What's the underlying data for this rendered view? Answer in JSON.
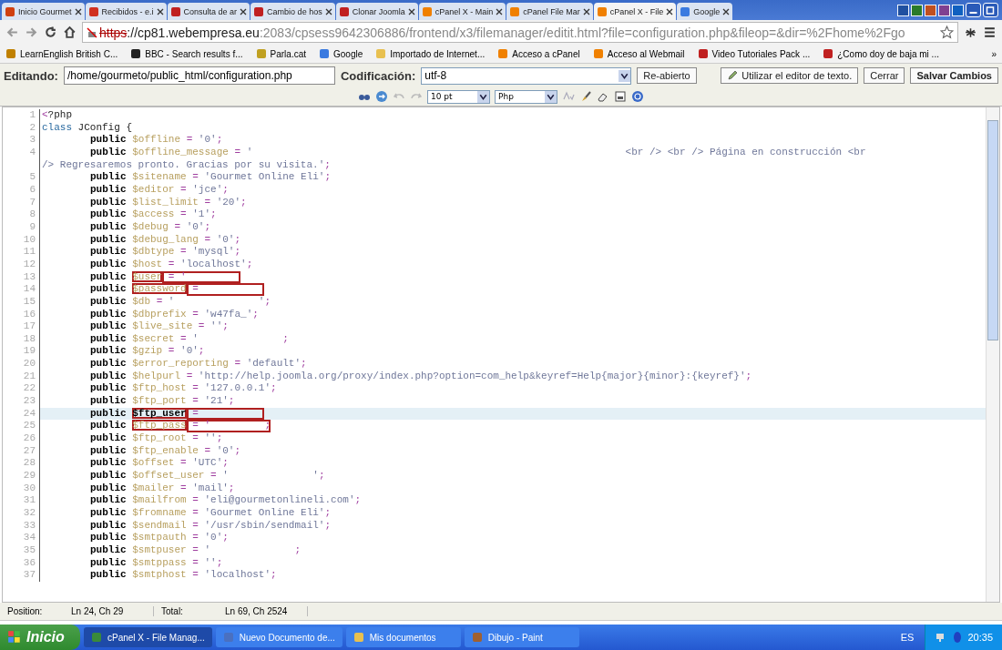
{
  "browser": {
    "tabs": [
      {
        "label": "Inicio Gourmet",
        "selected": false
      },
      {
        "label": "Recibidos - e.i",
        "selected": false
      },
      {
        "label": "Consulta de ar",
        "selected": false
      },
      {
        "label": "Cambio de hos",
        "selected": false
      },
      {
        "label": "Clonar Joomla",
        "selected": false
      },
      {
        "label": "cPanel X - Main",
        "selected": false
      },
      {
        "label": "cPanel File Mar",
        "selected": false
      },
      {
        "label": "cPanel X - File",
        "selected": true
      },
      {
        "label": "Google",
        "selected": false
      }
    ],
    "address": {
      "scheme": "https",
      "host": "://cp81.webempresa.eu",
      "path": ":2083/cpsess9642306886/frontend/x3/filemanager/editit.html?file=configuration.php&fileop=&dir=%2Fhome%2Fgo"
    },
    "bookmarks": [
      {
        "label": "LearnEnglish British C..."
      },
      {
        "label": "BBC - Search results f..."
      },
      {
        "label": "Parla.cat"
      },
      {
        "label": "Google"
      },
      {
        "label": "Importado de Internet..."
      },
      {
        "label": "Acceso a cPanel"
      },
      {
        "label": "Acceso al Webmail"
      },
      {
        "label": "Video Tutoriales Pack ..."
      },
      {
        "label": "¿Como doy de baja mi ..."
      }
    ],
    "bookmarks_more": "»"
  },
  "editor": {
    "editing_label": "Editando:",
    "path": "/home/gourmeto/public_html/configuration.php",
    "encoding_label": "Codificación:",
    "encoding": "utf-8",
    "reopen": "Re-abierto",
    "text_editor": "Utilizar el editor de texto.",
    "close": "Cerrar",
    "save": "Salvar Cambios",
    "font_size": "10 pt",
    "syntax": "Php"
  },
  "lines": [
    {
      "num": "1",
      "parts": [
        {
          "kind": "op",
          "text": "<"
        },
        {
          "kind": "plain",
          "text": "?php"
        }
      ]
    },
    {
      "num": "2",
      "parts": [
        {
          "kind": "cls",
          "text": "class "
        },
        {
          "kind": "plain",
          "text": "JConfig {"
        }
      ]
    },
    {
      "num": "3",
      "parts": [
        {
          "kind": "kw",
          "text": "public "
        },
        {
          "kind": "var",
          "text": "$offline"
        },
        {
          "kind": "op",
          "text": " = "
        },
        {
          "kind": "str",
          "text": "'0'"
        },
        {
          "kind": "op",
          "text": ";"
        }
      ]
    },
    {
      "num": "4",
      "parts": [
        {
          "kind": "kw",
          "text": "public "
        },
        {
          "kind": "var",
          "text": "$offline_message"
        },
        {
          "kind": "op",
          "text": " = "
        },
        {
          "kind": "str",
          "text": "'"
        },
        {
          "kind": "long"
        },
        {
          "kind": "str",
          "text": "<br /> <br /> Página en construcción <br"
        }
      ]
    },
    {
      "parts": [
        {
          "kind": "str",
          "text": "/> Regresaremos pronto. Gracias por su visita.'"
        },
        {
          "kind": "op",
          "text": ";"
        }
      ]
    },
    {
      "num": "5",
      "parts": [
        {
          "kind": "kw",
          "text": "public "
        },
        {
          "kind": "var",
          "text": "$sitename"
        },
        {
          "kind": "op",
          "text": " = "
        },
        {
          "kind": "str",
          "text": "'Gourmet Online Eli'"
        },
        {
          "kind": "op",
          "text": ";"
        }
      ]
    },
    {
      "num": "6",
      "parts": [
        {
          "kind": "kw",
          "text": "public "
        },
        {
          "kind": "var",
          "text": "$editor"
        },
        {
          "kind": "op",
          "text": " = "
        },
        {
          "kind": "str",
          "text": "'jce'"
        },
        {
          "kind": "op",
          "text": ";"
        }
      ]
    },
    {
      "num": "7",
      "parts": [
        {
          "kind": "kw",
          "text": "public "
        },
        {
          "kind": "var",
          "text": "$list_limit"
        },
        {
          "kind": "op",
          "text": " = "
        },
        {
          "kind": "str",
          "text": "'20'"
        },
        {
          "kind": "op",
          "text": ";"
        }
      ]
    },
    {
      "num": "8",
      "parts": [
        {
          "kind": "kw",
          "text": "public "
        },
        {
          "kind": "var",
          "text": "$access"
        },
        {
          "kind": "op",
          "text": " = "
        },
        {
          "kind": "str",
          "text": "'1'"
        },
        {
          "kind": "op",
          "text": ";"
        }
      ]
    },
    {
      "num": "9",
      "parts": [
        {
          "kind": "kw",
          "text": "public "
        },
        {
          "kind": "var",
          "text": "$debug"
        },
        {
          "kind": "op",
          "text": " = "
        },
        {
          "kind": "str",
          "text": "'0'"
        },
        {
          "kind": "op",
          "text": ";"
        }
      ]
    },
    {
      "num": "10",
      "parts": [
        {
          "kind": "kw",
          "text": "public "
        },
        {
          "kind": "var",
          "text": "$debug_lang"
        },
        {
          "kind": "op",
          "text": " = "
        },
        {
          "kind": "str",
          "text": "'0'"
        },
        {
          "kind": "op",
          "text": ";"
        }
      ]
    },
    {
      "num": "11",
      "parts": [
        {
          "kind": "kw",
          "text": "public "
        },
        {
          "kind": "var",
          "text": "$dbtype"
        },
        {
          "kind": "op",
          "text": " = "
        },
        {
          "kind": "str",
          "text": "'mysql'"
        },
        {
          "kind": "op",
          "text": ";"
        }
      ]
    },
    {
      "num": "12",
      "parts": [
        {
          "kind": "kw",
          "text": "public "
        },
        {
          "kind": "var",
          "text": "$host"
        },
        {
          "kind": "op",
          "text": " = "
        },
        {
          "kind": "str",
          "text": "'localhost'"
        },
        {
          "kind": "op",
          "text": ";"
        }
      ]
    },
    {
      "num": "13",
      "annotated": true,
      "parts": [
        {
          "kind": "kw",
          "text": "public "
        },
        {
          "kind": "var",
          "text": "$user"
        },
        {
          "kind": "hidden",
          "text": " = '"
        }
      ]
    },
    {
      "num": "14",
      "annotated": true,
      "parts": [
        {
          "kind": "kw",
          "text": "public "
        },
        {
          "kind": "var",
          "text": "$password"
        },
        {
          "kind": "hidden",
          "text": " ="
        }
      ]
    },
    {
      "num": "15",
      "parts": [
        {
          "kind": "kw",
          "text": "public "
        },
        {
          "kind": "var",
          "text": "$db"
        },
        {
          "kind": "op",
          "text": " = "
        },
        {
          "kind": "str",
          "text": "'"
        },
        {
          "kind": "gap"
        },
        {
          "kind": "str",
          "text": "'"
        },
        {
          "kind": "op",
          "text": ";"
        }
      ]
    },
    {
      "num": "16",
      "parts": [
        {
          "kind": "kw",
          "text": "public "
        },
        {
          "kind": "var",
          "text": "$dbprefix"
        },
        {
          "kind": "op",
          "text": " = "
        },
        {
          "kind": "str",
          "text": "'w47fa_'"
        },
        {
          "kind": "op",
          "text": ";"
        }
      ]
    },
    {
      "num": "17",
      "parts": [
        {
          "kind": "kw",
          "text": "public "
        },
        {
          "kind": "var",
          "text": "$live_site"
        },
        {
          "kind": "op",
          "text": " = "
        },
        {
          "kind": "str",
          "text": "''"
        },
        {
          "kind": "op",
          "text": ";"
        }
      ]
    },
    {
      "num": "18",
      "parts": [
        {
          "kind": "kw",
          "text": "public "
        },
        {
          "kind": "var",
          "text": "$secret"
        },
        {
          "kind": "op",
          "text": " = "
        },
        {
          "kind": "str",
          "text": "'"
        },
        {
          "kind": "gap"
        },
        {
          "kind": "op",
          "text": ";"
        }
      ]
    },
    {
      "num": "19",
      "parts": [
        {
          "kind": "kw",
          "text": "public "
        },
        {
          "kind": "var",
          "text": "$gzip"
        },
        {
          "kind": "op",
          "text": " = "
        },
        {
          "kind": "str",
          "text": "'0'"
        },
        {
          "kind": "op",
          "text": ";"
        }
      ]
    },
    {
      "num": "20",
      "parts": [
        {
          "kind": "kw",
          "text": "public "
        },
        {
          "kind": "var",
          "text": "$error_reporting"
        },
        {
          "kind": "op",
          "text": " = "
        },
        {
          "kind": "str",
          "text": "'default'"
        },
        {
          "kind": "op",
          "text": ";"
        }
      ]
    },
    {
      "num": "21",
      "parts": [
        {
          "kind": "kw",
          "text": "public "
        },
        {
          "kind": "var",
          "text": "$helpurl"
        },
        {
          "kind": "op",
          "text": " = "
        },
        {
          "kind": "str",
          "text": "'http://help.joomla.org/proxy/index.php?option=com_help&keyref=Help{major}{minor}:{keyref}'"
        },
        {
          "kind": "op",
          "text": ";"
        }
      ]
    },
    {
      "num": "22",
      "parts": [
        {
          "kind": "kw",
          "text": "public "
        },
        {
          "kind": "var",
          "text": "$ftp_host"
        },
        {
          "kind": "op",
          "text": " = "
        },
        {
          "kind": "str",
          "text": "'127.0.0.1'"
        },
        {
          "kind": "op",
          "text": ";"
        }
      ]
    },
    {
      "num": "23",
      "parts": [
        {
          "kind": "kw",
          "text": "public "
        },
        {
          "kind": "var",
          "text": "$ftp_port"
        },
        {
          "kind": "op",
          "text": " = "
        },
        {
          "kind": "str",
          "text": "'21'"
        },
        {
          "kind": "op",
          "text": ";"
        }
      ]
    },
    {
      "num": "24",
      "current": true,
      "annotated": true,
      "parts": [
        {
          "kind": "kw",
          "text": "public "
        },
        {
          "kind": "var",
          "text": "$ftp_user"
        },
        {
          "kind": "hidden",
          "text": " ="
        }
      ]
    },
    {
      "num": "25",
      "annotated": true,
      "parts": [
        {
          "kind": "kw",
          "text": "public "
        },
        {
          "kind": "var",
          "text": "$ftp_pass"
        },
        {
          "kind": "hidden",
          "text": " = '         ;"
        }
      ]
    },
    {
      "num": "26",
      "parts": [
        {
          "kind": "kw",
          "text": "public "
        },
        {
          "kind": "var",
          "text": "$ftp_root"
        },
        {
          "kind": "op",
          "text": " = "
        },
        {
          "kind": "str",
          "text": "''"
        },
        {
          "kind": "op",
          "text": ";"
        }
      ]
    },
    {
      "num": "27",
      "parts": [
        {
          "kind": "kw",
          "text": "public "
        },
        {
          "kind": "var",
          "text": "$ftp_enable"
        },
        {
          "kind": "op",
          "text": " = "
        },
        {
          "kind": "str",
          "text": "'0'"
        },
        {
          "kind": "op",
          "text": ";"
        }
      ]
    },
    {
      "num": "28",
      "parts": [
        {
          "kind": "kw",
          "text": "public "
        },
        {
          "kind": "var",
          "text": "$offset"
        },
        {
          "kind": "op",
          "text": " = "
        },
        {
          "kind": "str",
          "text": "'UTC'"
        },
        {
          "kind": "op",
          "text": ";"
        }
      ]
    },
    {
      "num": "29",
      "parts": [
        {
          "kind": "kw",
          "text": "public "
        },
        {
          "kind": "var",
          "text": "$offset_user"
        },
        {
          "kind": "op",
          "text": " = "
        },
        {
          "kind": "str",
          "text": "'"
        },
        {
          "kind": "gap"
        },
        {
          "kind": "str",
          "text": "'"
        },
        {
          "kind": "op",
          "text": ";"
        }
      ]
    },
    {
      "num": "30",
      "parts": [
        {
          "kind": "kw",
          "text": "public "
        },
        {
          "kind": "var",
          "text": "$mailer"
        },
        {
          "kind": "op",
          "text": " = "
        },
        {
          "kind": "str",
          "text": "'mail'"
        },
        {
          "kind": "op",
          "text": ";"
        }
      ]
    },
    {
      "num": "31",
      "parts": [
        {
          "kind": "kw",
          "text": "public "
        },
        {
          "kind": "var",
          "text": "$mailfrom"
        },
        {
          "kind": "op",
          "text": " = "
        },
        {
          "kind": "str",
          "text": "'eli@gourmetonlineli.com'"
        },
        {
          "kind": "op",
          "text": ";"
        }
      ]
    },
    {
      "num": "32",
      "parts": [
        {
          "kind": "kw",
          "text": "public "
        },
        {
          "kind": "var",
          "text": "$fromname"
        },
        {
          "kind": "op",
          "text": " = "
        },
        {
          "kind": "str",
          "text": "'Gourmet Online Eli'"
        },
        {
          "kind": "op",
          "text": ";"
        }
      ]
    },
    {
      "num": "33",
      "parts": [
        {
          "kind": "kw",
          "text": "public "
        },
        {
          "kind": "var",
          "text": "$sendmail"
        },
        {
          "kind": "op",
          "text": " = "
        },
        {
          "kind": "str",
          "text": "'/usr/sbin/sendmail'"
        },
        {
          "kind": "op",
          "text": ";"
        }
      ]
    },
    {
      "num": "34",
      "parts": [
        {
          "kind": "kw",
          "text": "public "
        },
        {
          "kind": "var",
          "text": "$smtpauth"
        },
        {
          "kind": "op",
          "text": " = "
        },
        {
          "kind": "str",
          "text": "'0'"
        },
        {
          "kind": "op",
          "text": ";"
        }
      ]
    },
    {
      "num": "35",
      "parts": [
        {
          "kind": "kw",
          "text": "public "
        },
        {
          "kind": "var",
          "text": "$smtpuser"
        },
        {
          "kind": "op",
          "text": " = "
        },
        {
          "kind": "str",
          "text": "'"
        },
        {
          "kind": "gap"
        },
        {
          "kind": "op",
          "text": ";"
        }
      ]
    },
    {
      "num": "36",
      "parts": [
        {
          "kind": "kw",
          "text": "public "
        },
        {
          "kind": "var",
          "text": "$smtppass"
        },
        {
          "kind": "op",
          "text": " = "
        },
        {
          "kind": "str",
          "text": "''"
        },
        {
          "kind": "op",
          "text": ";"
        }
      ]
    },
    {
      "num": "37",
      "parts": [
        {
          "kind": "kw",
          "text": "public "
        },
        {
          "kind": "var",
          "text": "$smtphost"
        },
        {
          "kind": "op",
          "text": " = "
        },
        {
          "kind": "str",
          "text": "'localhost'"
        },
        {
          "kind": "op",
          "text": ";"
        }
      ]
    }
  ],
  "status": {
    "position_label": "Position:",
    "position": "Ln 24, Ch 29",
    "total_label": "Total:",
    "total": "Ln 69, Ch 2524"
  },
  "taskbar": {
    "start": "Inicio",
    "items": [
      {
        "label": "cPanel X - File Manag...",
        "selected": true
      },
      {
        "label": "Nuevo Documento de...",
        "selected": false
      },
      {
        "label": "Mis documentos",
        "selected": false
      },
      {
        "label": "Dibujo - Paint",
        "selected": false
      }
    ],
    "language": "ES",
    "clock": "20:35"
  }
}
